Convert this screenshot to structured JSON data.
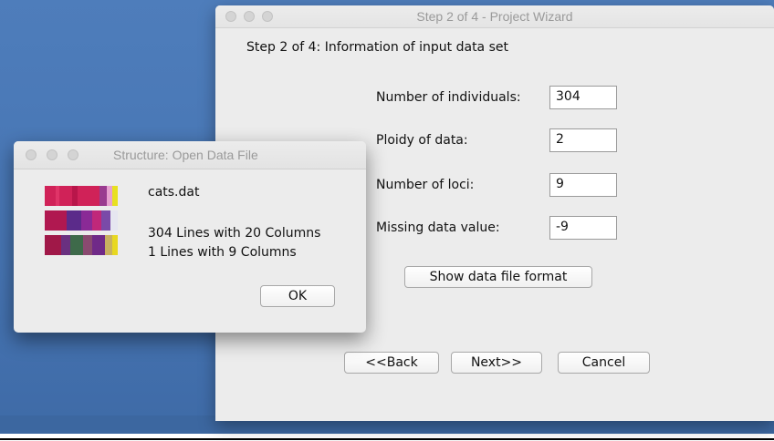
{
  "wizard": {
    "title": "Step 2 of 4 - Project Wizard",
    "heading": "Step 2 of 4: Information of input data set",
    "fields": [
      {
        "label": "Number of individuals:",
        "value": "304"
      },
      {
        "label": "Ploidy of data:",
        "value": "2"
      },
      {
        "label": "Number of loci:",
        "value": "9"
      },
      {
        "label": "Missing data value:",
        "value": "-9"
      }
    ],
    "show_format_label": "Show data file format",
    "back_label": "<<Back",
    "next_label": "Next>>",
    "cancel_label": "Cancel"
  },
  "dialog": {
    "title": "Structure: Open Data File",
    "filename": "cats.dat",
    "line1": "304 Lines with 20 Columns",
    "line2": "1 Lines with 9 Columns",
    "ok_label": "OK",
    "icon_name": "structure-bar-plot-icon"
  },
  "colors": {
    "desktop": "#4b79b6",
    "window": "#ececec"
  }
}
